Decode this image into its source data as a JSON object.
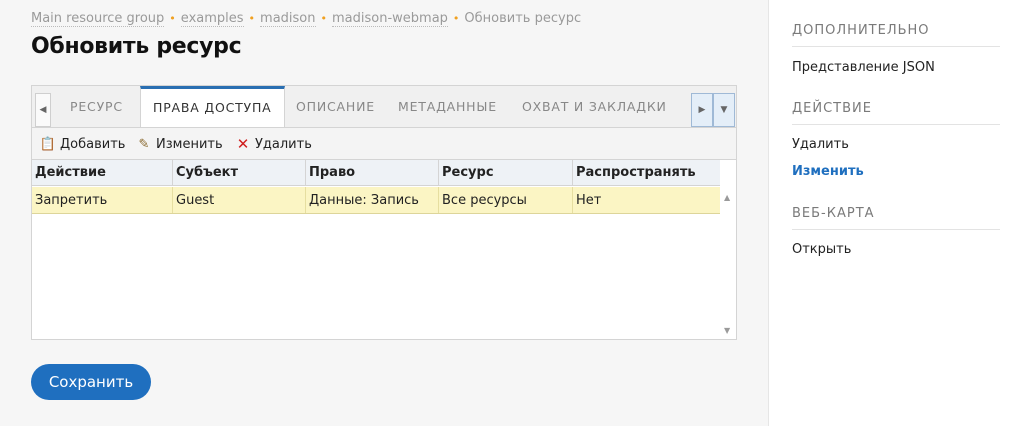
{
  "breadcrumb": {
    "items": [
      "Main resource group",
      "examples",
      "madison",
      "madison-webmap"
    ],
    "separator": "•",
    "current": "Обновить ресурс"
  },
  "page_title": "Обновить ресурс",
  "tabs": {
    "prev_icon": "◀",
    "next_icon": "▶",
    "menu_icon": "▼",
    "items": [
      {
        "label": "РЕСУРС",
        "active": false
      },
      {
        "label": "ПРАВА ДОСТУПА",
        "active": true
      },
      {
        "label": "ОПИСАНИЕ",
        "active": false
      },
      {
        "label": "МЕТАДАННЫЕ",
        "active": false
      },
      {
        "label": "ОХВАТ И ЗАКЛАДКИ",
        "active": false
      }
    ]
  },
  "toolbar": {
    "add_label": "Добавить",
    "edit_label": "Изменить",
    "delete_label": "Удалить",
    "add_icon": "📋",
    "edit_icon": "✎",
    "delete_icon": "✕"
  },
  "table": {
    "columns": [
      "Действие",
      "Субъект",
      "Право",
      "Ресурс",
      "Распространять"
    ],
    "rows": [
      [
        "Запретить",
        "Guest",
        "Данные: Запись",
        "Все ресурсы",
        "Нет"
      ]
    ],
    "scroll_up": "▲",
    "scroll_down": "▼"
  },
  "save_button": "Сохранить",
  "sidebar": {
    "sections": [
      {
        "title": "ДОПОЛНИТЕЛЬНО",
        "items": [
          {
            "label": "Представление JSON",
            "active": false
          }
        ]
      },
      {
        "title": "ДЕЙСТВИЕ",
        "items": [
          {
            "label": "Удалить",
            "active": false
          },
          {
            "label": "Изменить",
            "active": true
          }
        ]
      },
      {
        "title": "ВЕБ-КАРТА",
        "items": [
          {
            "label": "Открыть",
            "active": false
          }
        ]
      }
    ]
  },
  "colors": {
    "accent": "#1f6fbf",
    "tab_active_border": "#2a6fb2",
    "selected_row": "#fbf5c4",
    "breadcrumb_separator": "#f0a020"
  }
}
